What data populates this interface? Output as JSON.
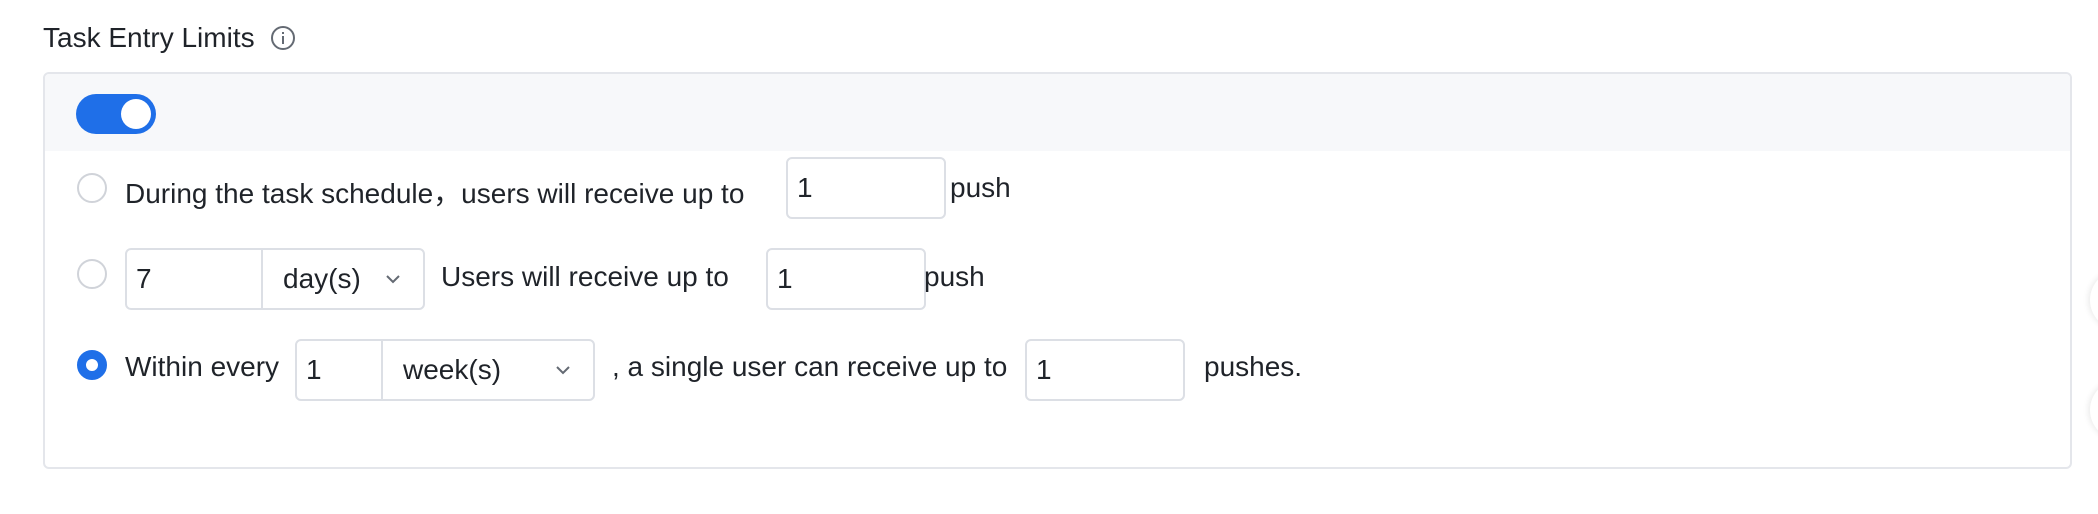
{
  "section": {
    "title": "Task Entry Limits",
    "info_icon": "info-circle-icon"
  },
  "toggle": {
    "enabled": true,
    "accent": "#1f6fe8"
  },
  "options": [
    {
      "selected": false,
      "text_before": "During the task schedule，users will receive up to",
      "limit_value": "1",
      "text_after": "push"
    },
    {
      "selected": false,
      "period_value": "7",
      "period_unit": "day(s)",
      "text_middle": "Users will receive up to",
      "limit_value": "1",
      "text_after": "push"
    },
    {
      "selected": true,
      "text_before": "Within every",
      "period_value": "1",
      "period_unit": "week(s)",
      "text_middle": ", a single user can receive up to",
      "limit_value": "1",
      "text_after": "pushes."
    }
  ]
}
